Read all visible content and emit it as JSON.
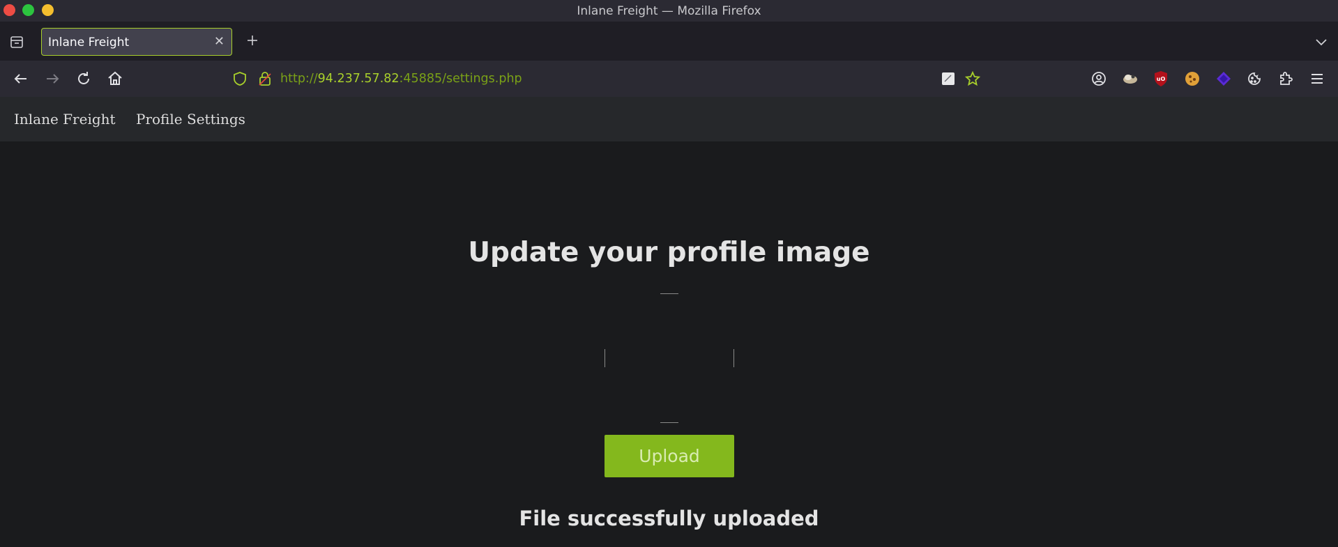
{
  "window": {
    "title": "Inlane Freight — Mozilla Firefox"
  },
  "tabs": [
    {
      "label": "Inlane Freight",
      "active": true
    }
  ],
  "address_bar": {
    "url_scheme": "http://",
    "url_host": "94.237.57.82",
    "url_rest": ":45885/settings.php"
  },
  "page": {
    "nav": {
      "brand": "Inlane Freight",
      "link": "Profile Settings"
    },
    "heading": "Update your profile image",
    "upload_button": "Upload",
    "status_message": "File successfully uploaded"
  },
  "colors": {
    "accent": "#a9d02b",
    "upload_button": "#84b81d"
  },
  "icons": [
    "tab-list-icon",
    "close-icon",
    "plus-icon",
    "chevron-down-icon",
    "back-icon",
    "forward-icon",
    "reload-icon",
    "home-icon",
    "shield-icon",
    "insecure-lock-icon",
    "reader-view-icon",
    "bookmark-star-icon",
    "account-icon",
    "extension-icon",
    "ublock-icon",
    "cookie-icon",
    "diamond-icon",
    "puzzle-icon",
    "hamburger-menu-icon"
  ]
}
